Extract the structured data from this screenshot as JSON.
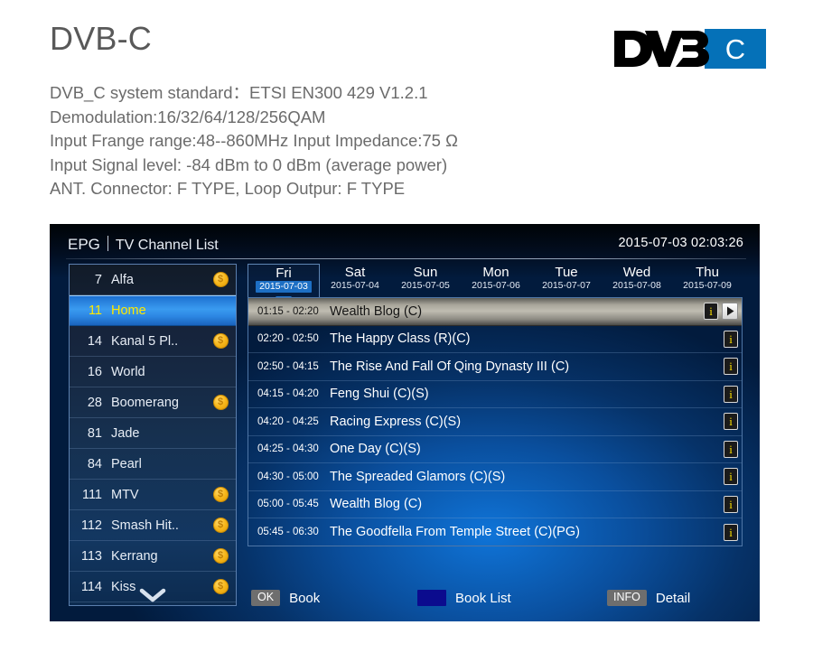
{
  "spec": {
    "title": "DVB-C",
    "lines": [
      " DVB_C system standard：ETSI EN300 429 V1.2.1",
      "Demodulation:16/32/64/128/256QAM",
      "Input Frange range:48--860MHz Input Impedance:75 Ω",
      "Input Signal level: -84 dBm to  0 dBm (average power)",
      "ANT. Connector: F TYPE, Loop Outpur: F TYPE"
    ]
  },
  "logo": {
    "mark_text": "DVB",
    "suffix_text": "C",
    "mark_color": "#000000",
    "suffix_bg": "#0571b8",
    "suffix_color": "#ffffff"
  },
  "epg": {
    "title": "EPG",
    "subtitle": "TV Channel List",
    "clock": "2015-07-03 02:03:26",
    "channels": [
      {
        "number": "7",
        "name": "Alfa",
        "scrambled": true,
        "selected": false
      },
      {
        "number": "11",
        "name": "Home",
        "scrambled": false,
        "selected": true
      },
      {
        "number": "14",
        "name": "Kanal 5 Pl..",
        "scrambled": true,
        "selected": false
      },
      {
        "number": "16",
        "name": "World",
        "scrambled": false,
        "selected": false
      },
      {
        "number": "28",
        "name": "Boomerang",
        "scrambled": true,
        "selected": false
      },
      {
        "number": "81",
        "name": "Jade",
        "scrambled": false,
        "selected": false
      },
      {
        "number": "84",
        "name": "Pearl",
        "scrambled": false,
        "selected": false
      },
      {
        "number": "111",
        "name": "MTV",
        "scrambled": true,
        "selected": false
      },
      {
        "number": "112",
        "name": "Smash Hit..",
        "scrambled": true,
        "selected": false
      },
      {
        "number": "113",
        "name": "Kerrang",
        "scrambled": true,
        "selected": false
      },
      {
        "number": "114",
        "name": "Kiss",
        "scrambled": true,
        "selected": false
      }
    ],
    "scroll_down_icon": "chevron-down-icon",
    "coin_icon_glyph": "$",
    "days": [
      {
        "name": "Fri",
        "date": "2015-07-03",
        "active": true
      },
      {
        "name": "Sat",
        "date": "2015-07-04",
        "active": false
      },
      {
        "name": "Sun",
        "date": "2015-07-05",
        "active": false
      },
      {
        "name": "Mon",
        "date": "2015-07-06",
        "active": false
      },
      {
        "name": "Tue",
        "date": "2015-07-07",
        "active": false
      },
      {
        "name": "Wed",
        "date": "2015-07-08",
        "active": false
      },
      {
        "name": "Thu",
        "date": "2015-07-09",
        "active": false
      }
    ],
    "programs": [
      {
        "time": "01:15 - 02:20",
        "title": "Wealth Blog (C)",
        "current": true,
        "has_play": true
      },
      {
        "time": "02:20 - 02:50",
        "title": "The Happy Class (R)(C)",
        "current": false,
        "has_play": false
      },
      {
        "time": "02:50 - 04:15",
        "title": "The Rise And Fall Of Qing Dynasty III (C)",
        "current": false,
        "has_play": false
      },
      {
        "time": "04:15 - 04:20",
        "title": "Feng Shui (C)(S)",
        "current": false,
        "has_play": false
      },
      {
        "time": "04:20 - 04:25",
        "title": "Racing Express (C)(S)",
        "current": false,
        "has_play": false
      },
      {
        "time": "04:25 - 04:30",
        "title": "One Day (C)(S)",
        "current": false,
        "has_play": false
      },
      {
        "time": "04:30 - 05:00",
        "title": "The Spreaded Glamors (C)(S)",
        "current": false,
        "has_play": false
      },
      {
        "time": "05:00 - 05:45",
        "title": "Wealth Blog (C)",
        "current": false,
        "has_play": false
      },
      {
        "time": "05:45 - 06:30",
        "title": "The Goodfella From Temple Street (C)(PG)",
        "current": false,
        "has_play": false
      }
    ],
    "info_icon_glyph": "i",
    "legend": {
      "book_key": "OK",
      "book_label": "Book",
      "booklist_swatch_color": "#0b0b8e",
      "booklist_label": "Book List",
      "detail_key": "INFO",
      "detail_label": "Detail"
    }
  }
}
